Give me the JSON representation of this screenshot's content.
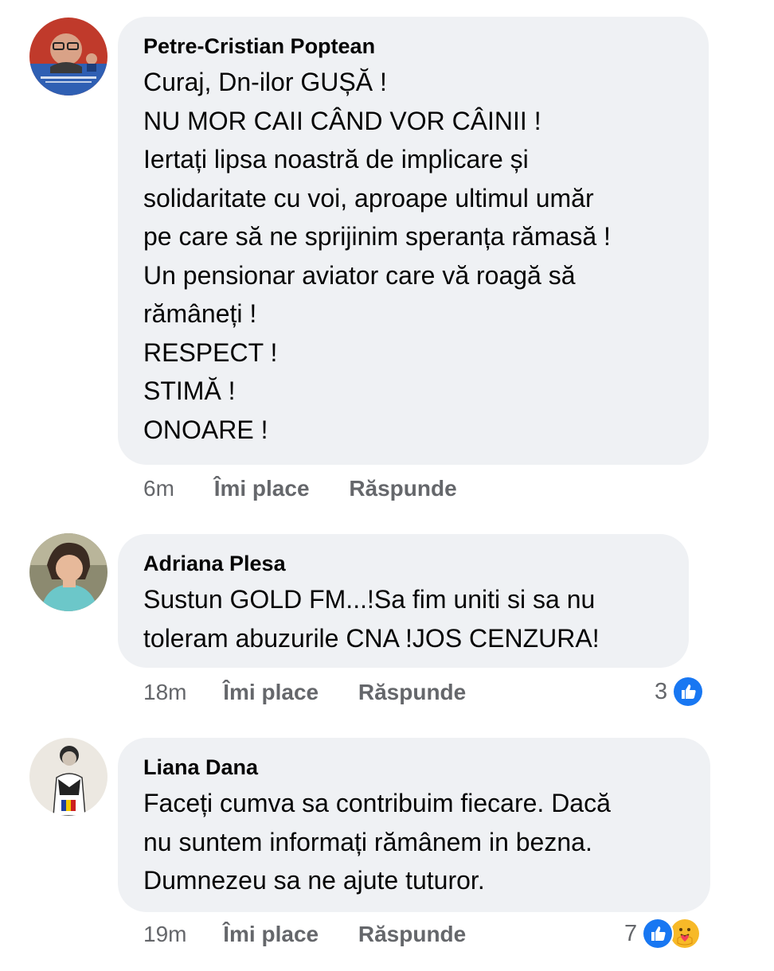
{
  "comments": [
    {
      "author": "Petre-Cristian Poptean",
      "lines": [
        "Curaj, Dn-ilor GUȘĂ !",
        "NU MOR CAII CÂND VOR CÂINII  !",
        "Iertați lipsa noastră de implicare și",
        "solidaritate cu voi, aproape ultimul umăr",
        "pe care să ne sprijinim speranța rămasă !",
        "Un pensionar aviator  care vă roagă să",
        "rămâneți  !",
        "RESPECT !",
        "STIMĂ  !",
        "ONOARE !"
      ],
      "time": "6m",
      "like_label": "Îmi place",
      "reply_label": "Răspunde"
    },
    {
      "author": "Adriana Plesa",
      "lines": [
        "Sustun GOLD FM...!Sa fim uniti si sa nu",
        "toleram abuzurile CNA !JOS CENZURA!"
      ],
      "time": "18m",
      "like_label": "Îmi place",
      "reply_label": "Răspunde",
      "reaction_count": "3",
      "reactions": [
        "like-icon"
      ]
    },
    {
      "author": "Liana Dana",
      "lines": [
        "Faceți cumva sa contribuim fiecare. Dacă",
        "nu suntem informați rămânem in bezna.",
        "Dumnezeu sa ne ajute tuturor."
      ],
      "time": "19m",
      "like_label": "Îmi place",
      "reply_label": "Răspunde",
      "reaction_count": "7",
      "reactions": [
        "like-icon",
        "care-icon"
      ]
    }
  ],
  "colors": {
    "bubble": "#eff1f4",
    "meta_text": "#65676b",
    "like_blue": "#1877f2",
    "care_yellow": "#f7b928"
  }
}
